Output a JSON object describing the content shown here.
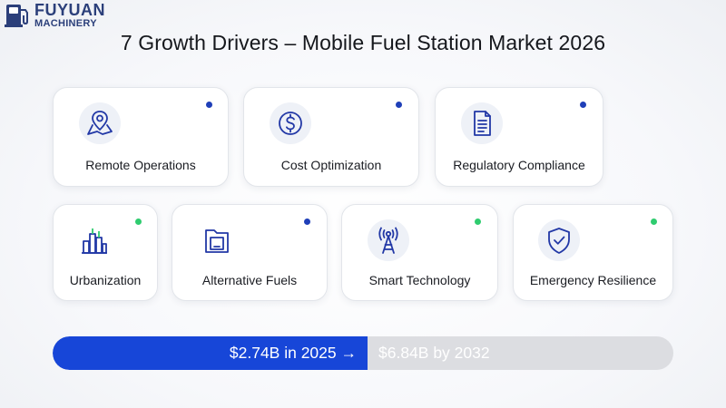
{
  "logo": {
    "line1": "FUYUAN",
    "line2": "MACHINERY",
    "mark_icon": "fuel-pump-logo-icon"
  },
  "title": "7 Growth Drivers – Mobile Fuel Station Market 2026",
  "colors": {
    "blue_dot": "#1f3fb8",
    "green_dot": "#2fcc6f",
    "icon_stroke": "#2238a6",
    "bar_fill": "#1746d8",
    "bar_track": "#dcdde1"
  },
  "drivers": [
    {
      "label": "Remote Operations",
      "icon": "map-pin-icon",
      "dot": "blue"
    },
    {
      "label": "Cost Optimization",
      "icon": "dollar-coin-icon",
      "dot": "blue"
    },
    {
      "label": "Regulatory Compliance",
      "icon": "document-icon",
      "dot": "blue"
    },
    {
      "label": "Urbanization",
      "icon": "city-buildings-icon",
      "dot": "green"
    },
    {
      "label": "Alternative Fuels",
      "icon": "fuel-can-icon",
      "dot": "blue"
    },
    {
      "label": "Smart Technology",
      "icon": "antenna-tower-icon",
      "dot": "green"
    },
    {
      "label": "Emergency Resilience",
      "icon": "shield-check-icon",
      "dot": "green"
    }
  ],
  "market": {
    "start_text": "$2.74B in 2025 →",
    "end_text": "$6.84B by 2032",
    "progress_fraction": 0.507
  }
}
